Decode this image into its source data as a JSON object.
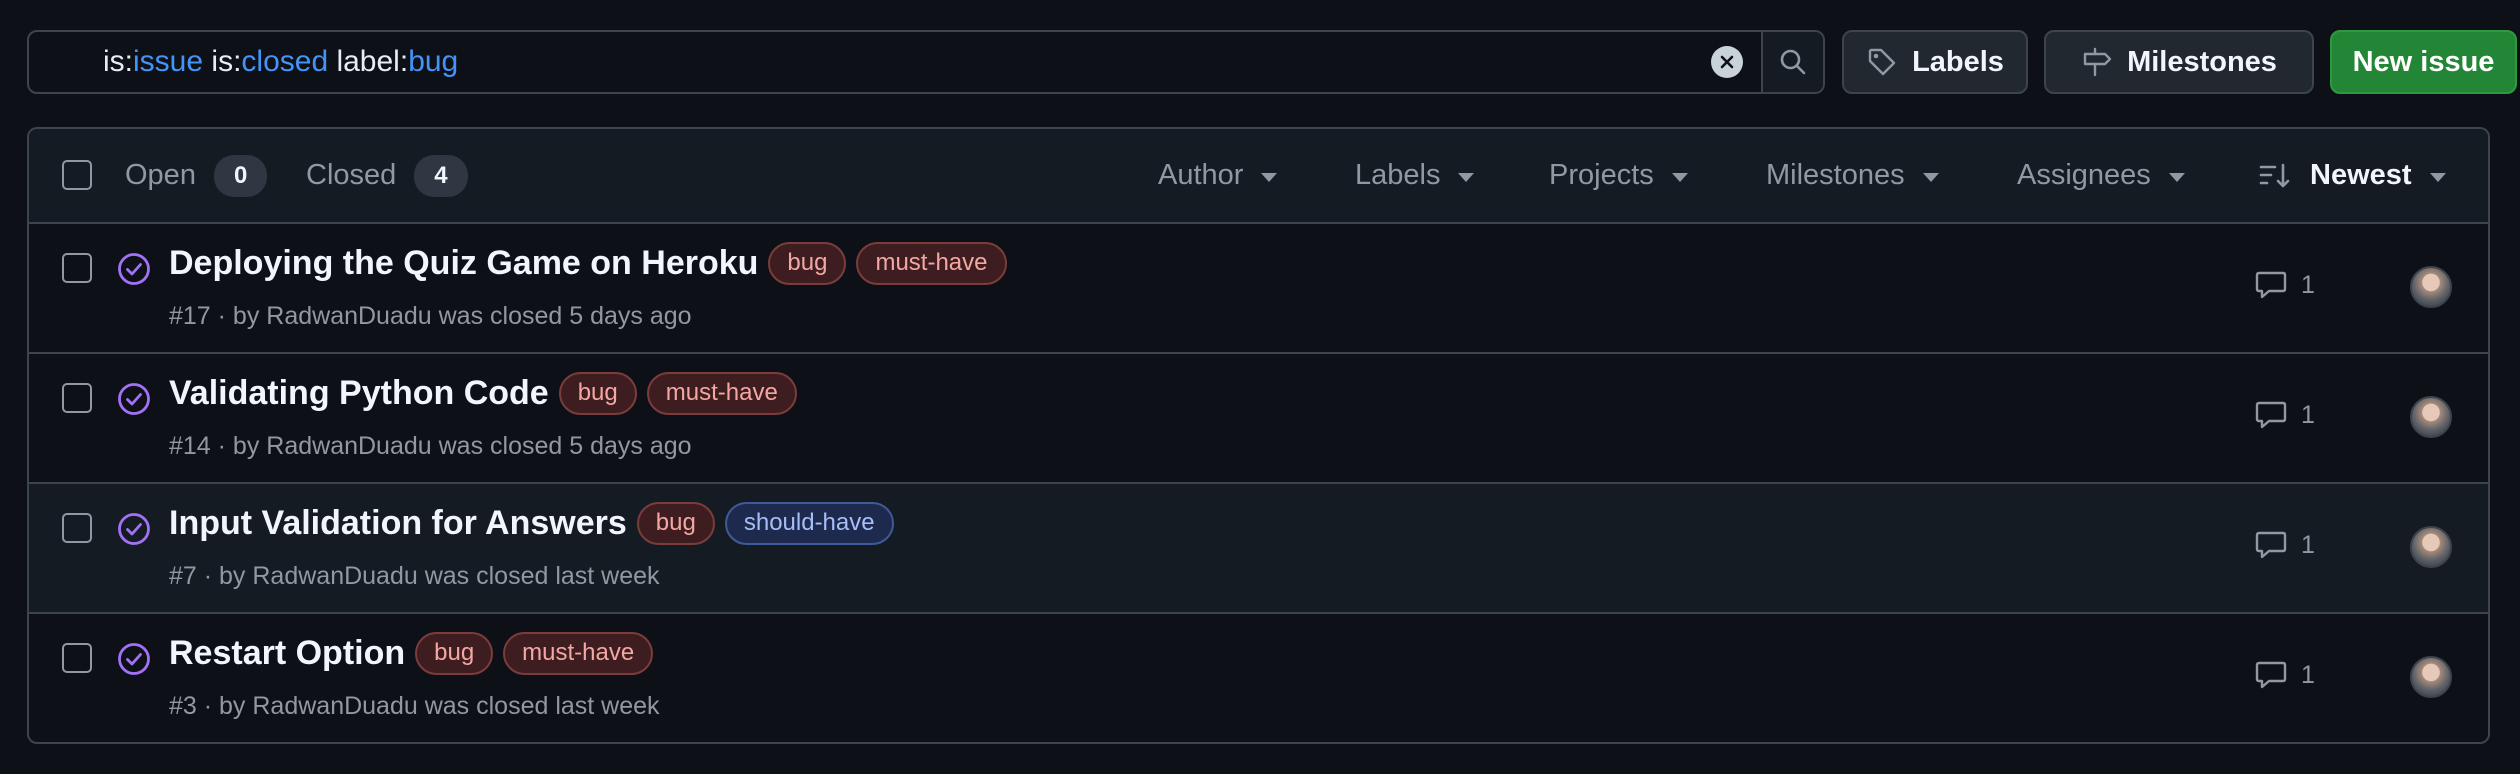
{
  "search": {
    "tokens": [
      {
        "q": "is:",
        "v": "issue"
      },
      {
        "q": " is:",
        "v": "closed"
      },
      {
        "q": " label:",
        "v": "bug"
      }
    ]
  },
  "buttons": {
    "labels": "Labels",
    "milestones": "Milestones",
    "new_issue": "New issue"
  },
  "colors": {
    "accent": "#4493f8",
    "new_issue_bg": "#238636",
    "closed_icon": "#a371f7"
  },
  "header": {
    "open_label": "Open",
    "open_count": "0",
    "closed_label": "Closed",
    "closed_count": "4",
    "filters": {
      "author": "Author",
      "labels": "Labels",
      "projects": "Projects",
      "milestones": "Milestones",
      "assignees": "Assignees",
      "sort": "Newest"
    }
  },
  "issues": [
    {
      "title": "Deploying the Quiz Game on Heroku",
      "labels": [
        {
          "name": "bug",
          "kind": "bug"
        },
        {
          "name": "must-have",
          "kind": "must"
        }
      ],
      "meta": "#17 · by RadwanDuadu was closed 5 days ago",
      "comments": "1"
    },
    {
      "title": "Validating Python Code",
      "labels": [
        {
          "name": "bug",
          "kind": "bug"
        },
        {
          "name": "must-have",
          "kind": "must"
        }
      ],
      "meta": "#14 · by RadwanDuadu was closed 5 days ago",
      "comments": "1"
    },
    {
      "title": "Input Validation for Answers",
      "labels": [
        {
          "name": "bug",
          "kind": "bug"
        },
        {
          "name": "should-have",
          "kind": "should"
        }
      ],
      "meta": "#7 · by RadwanDuadu was closed last week",
      "comments": "1"
    },
    {
      "title": "Restart Option",
      "labels": [
        {
          "name": "bug",
          "kind": "bug"
        },
        {
          "name": "must-have",
          "kind": "must"
        }
      ],
      "meta": "#3 · by RadwanDuadu was closed last week",
      "comments": "1"
    }
  ]
}
